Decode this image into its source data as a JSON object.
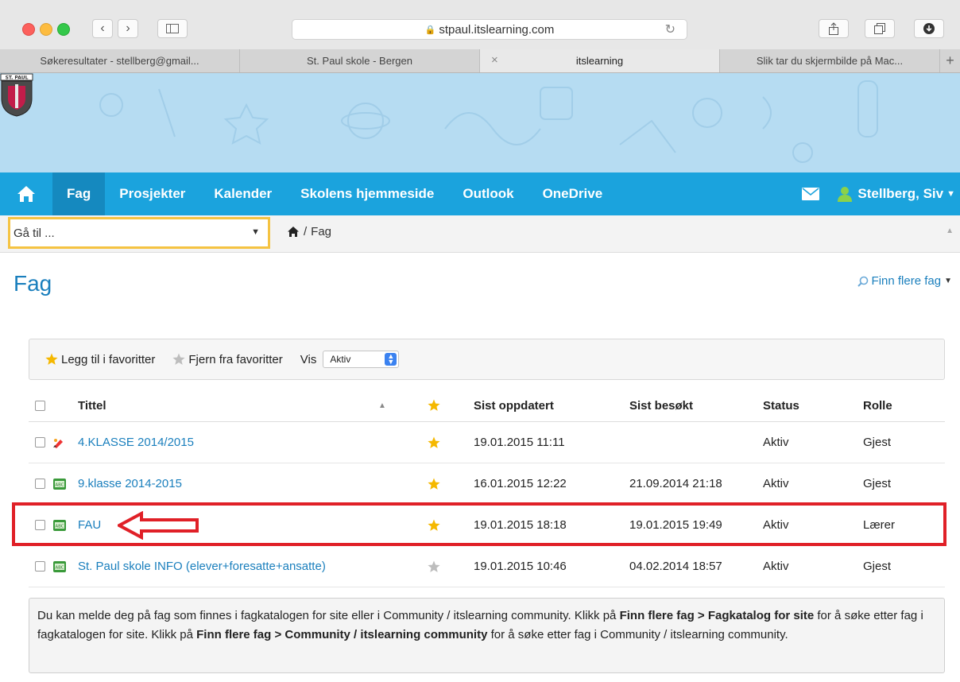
{
  "browser": {
    "url": "stpaul.itslearning.com",
    "tabs": [
      {
        "label": "Søkeresultater - stellberg@gmail...",
        "active": false
      },
      {
        "label": "St. Paul skole - Bergen",
        "active": false
      },
      {
        "label": "itslearning",
        "active": true
      },
      {
        "label": "Slik tar du skjermbilde på Mac...",
        "active": false
      }
    ],
    "new_tab_label": "+"
  },
  "school": {
    "logo_text": "ST. PAUL"
  },
  "nav": {
    "items": [
      "Fag",
      "Prosjekter",
      "Kalender",
      "Skolens hjemmeside",
      "Outlook",
      "OneDrive"
    ],
    "active": "Fag",
    "user": "Stellberg, Siv"
  },
  "breadcrumb": {
    "goto_placeholder": "Gå til ...",
    "separator": "/",
    "current": "Fag"
  },
  "page": {
    "title": "Fag",
    "find_more": "Finn flere fag"
  },
  "actions": {
    "add_favorite": "Legg til i favoritter",
    "remove_favorite": "Fjern fra favoritter",
    "show_label": "Vis",
    "show_value": "Aktiv"
  },
  "table": {
    "headers": {
      "title": "Tittel",
      "updated": "Sist oppdatert",
      "visited": "Sist besøkt",
      "status": "Status",
      "role": "Rolle"
    },
    "rows": [
      {
        "title": "4.KLASSE 2014/2015",
        "favorite": true,
        "updated": "19.01.2015 11:11",
        "visited": "",
        "status": "Aktiv",
        "role": "Gjest",
        "icon": "pencil-icon"
      },
      {
        "title": "9.klasse 2014-2015",
        "favorite": true,
        "updated": "16.01.2015 12:22",
        "visited": "21.09.2014 21:18",
        "status": "Aktiv",
        "role": "Gjest",
        "icon": "course-abc-icon"
      },
      {
        "title": "FAU",
        "favorite": true,
        "updated": "19.01.2015 18:18",
        "visited": "19.01.2015 19:49",
        "status": "Aktiv",
        "role": "Lærer",
        "icon": "course-abc-icon"
      },
      {
        "title": "St. Paul skole INFO (elever+foresatte+ansatte)",
        "favorite": false,
        "updated": "19.01.2015 10:46",
        "visited": "04.02.2014 18:57",
        "status": "Aktiv",
        "role": "Gjest",
        "icon": "course-abc-icon"
      }
    ]
  },
  "info": {
    "p1": "Du kan melde deg på fag som finnes i fagkatalogen for site eller i Community / itslearning community. Klikk på ",
    "b1": "Finn flere fag > Fagkatalog for site",
    "p2": " for å søke etter fag i fagkatalogen for site. Klikk på ",
    "b2": "Finn flere fag > Community / itslearning community",
    "p3": " for å søke etter fag i Community / itslearning community."
  },
  "colors": {
    "brand": "#1ba3dd",
    "link": "#1a7fbd",
    "highlight": "#e02027",
    "star": "#f5b800"
  }
}
